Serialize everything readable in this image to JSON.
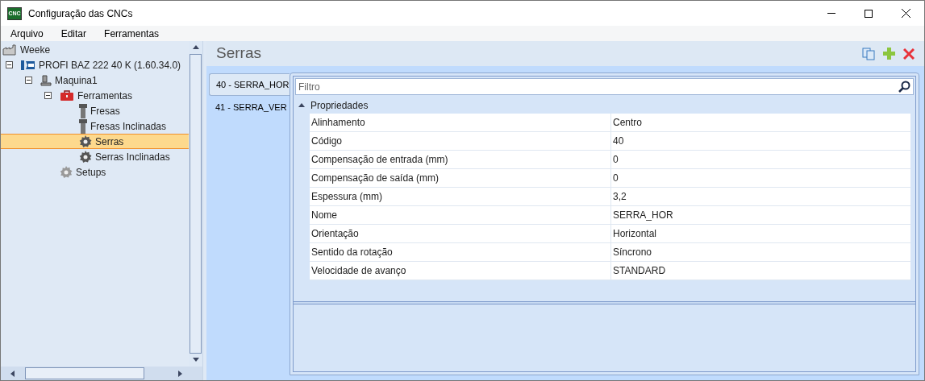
{
  "window": {
    "title": "Configuração das CNCs",
    "app_icon": "CNC"
  },
  "menu": [
    "Arquivo",
    "Editar",
    "Ferramentas"
  ],
  "tree": [
    {
      "label": "Weeke",
      "kind": "factory",
      "selected": false,
      "children": [
        {
          "label": "PROFI BAZ 222 40 K (1.60.34.0)",
          "kind": "brand",
          "selected": false,
          "expanded": true,
          "children": [
            {
              "label": "Maquina1",
              "kind": "machine",
              "selected": false,
              "expanded": true,
              "children": [
                {
                  "label": "Ferramentas",
                  "kind": "toolbox",
                  "selected": false,
                  "expanded": true,
                  "children": [
                    {
                      "label": "Fresas",
                      "kind": "mill",
                      "selected": false
                    },
                    {
                      "label": "Fresas Inclinadas",
                      "kind": "mill",
                      "selected": false
                    },
                    {
                      "label": "Serras",
                      "kind": "saw",
                      "selected": true
                    },
                    {
                      "label": "Serras Inclinadas",
                      "kind": "saw",
                      "selected": false
                    }
                  ]
                },
                {
                  "label": "Setups",
                  "kind": "gear",
                  "selected": false
                }
              ]
            }
          ]
        }
      ]
    }
  ],
  "panel": {
    "title": "Serras"
  },
  "tools": [
    {
      "label": "40 - SERRA_HOR",
      "selected": true
    },
    {
      "label": "41 - SERRA_VER",
      "selected": false
    }
  ],
  "filter": {
    "placeholder": "Filtro"
  },
  "properties": {
    "category": "Propriedades",
    "expanded": true,
    "rows": [
      {
        "name": "Alinhamento",
        "value": "Centro"
      },
      {
        "name": "Código",
        "value": "40"
      },
      {
        "name": "Compensação de entrada (mm)",
        "value": "0"
      },
      {
        "name": "Compensação de saída (mm)",
        "value": "0"
      },
      {
        "name": "Espessura (mm)",
        "value": "3,2"
      },
      {
        "name": "Nome",
        "value": "SERRA_HOR"
      },
      {
        "name": "Orientação",
        "value": "Horizontal"
      },
      {
        "name": "Sentido da rotação",
        "value": "Síncrono"
      },
      {
        "name": "Velocidade de avanço",
        "value": "STANDARD"
      }
    ]
  }
}
